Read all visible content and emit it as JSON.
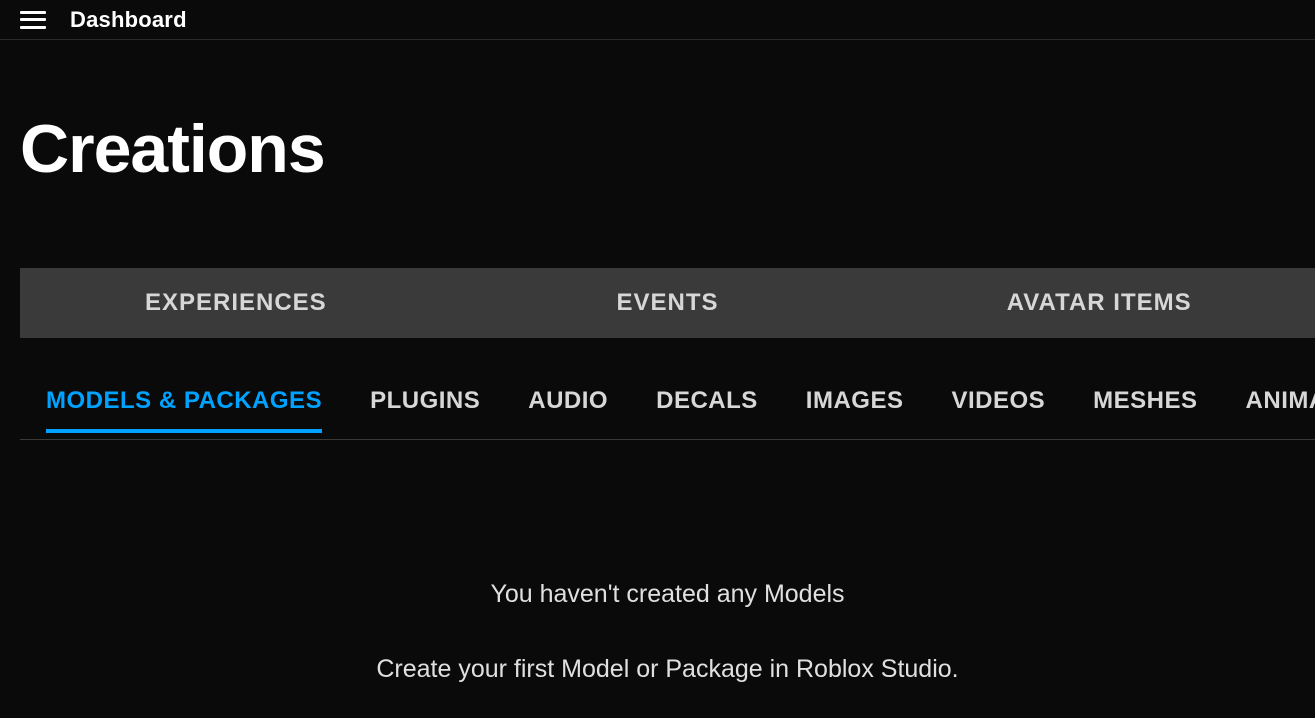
{
  "topbar": {
    "title": "Dashboard"
  },
  "page": {
    "title": "Creations"
  },
  "main_tabs": [
    {
      "id": "experiences",
      "label": "EXPERIENCES",
      "active": false
    },
    {
      "id": "events",
      "label": "EVENTS",
      "active": false
    },
    {
      "id": "avatar-items",
      "label": "AVATAR ITEMS",
      "active": false
    }
  ],
  "sub_tabs": [
    {
      "id": "models-packages",
      "label": "MODELS & PACKAGES",
      "active": true
    },
    {
      "id": "plugins",
      "label": "PLUGINS",
      "active": false
    },
    {
      "id": "audio",
      "label": "AUDIO",
      "active": false
    },
    {
      "id": "decals",
      "label": "DECALS",
      "active": false
    },
    {
      "id": "images",
      "label": "IMAGES",
      "active": false
    },
    {
      "id": "videos",
      "label": "VIDEOS",
      "active": false
    },
    {
      "id": "meshes",
      "label": "MESHES",
      "active": false
    },
    {
      "id": "animations",
      "label": "ANIMATIONS",
      "active": false
    }
  ],
  "empty_state": {
    "title": "You haven't created any Models",
    "subtitle": "Create your first Model or Package in Roblox Studio."
  },
  "colors": {
    "accent": "#00a2ff",
    "background": "#0a0a0a",
    "tab_bar": "#3a3a3a",
    "text": "#ffffff",
    "muted_text": "#d7d7d7"
  }
}
